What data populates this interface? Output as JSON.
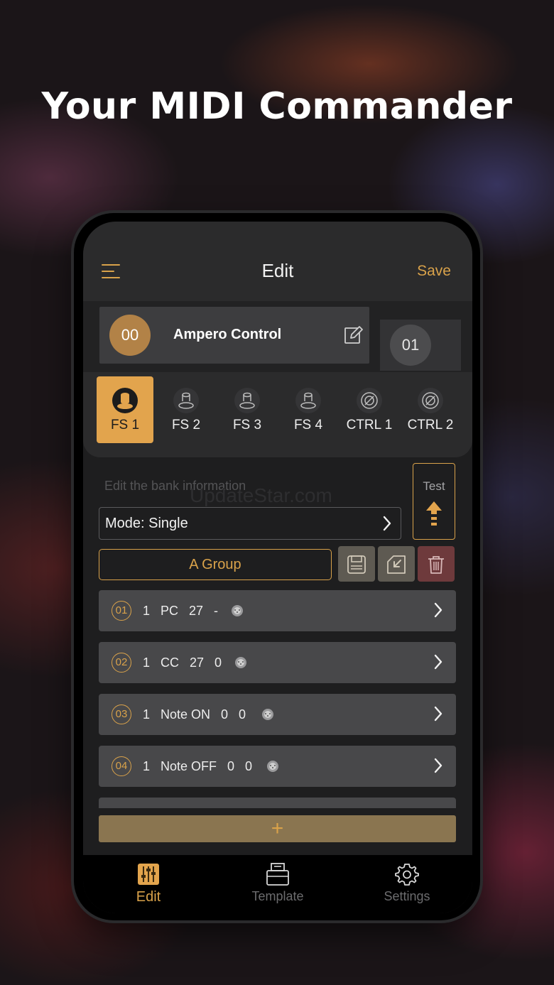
{
  "headline": "Your MIDI Commander",
  "nav": {
    "title": "Edit",
    "save_label": "Save"
  },
  "bank": {
    "number": "00",
    "name": "Ampero Control",
    "next_number": "01"
  },
  "footswitches": [
    {
      "label": "FS 1",
      "type": "footswitch",
      "active": true
    },
    {
      "label": "FS 2",
      "type": "footswitch",
      "active": false
    },
    {
      "label": "FS 3",
      "type": "footswitch",
      "active": false
    },
    {
      "label": "FS 4",
      "type": "footswitch",
      "active": false
    },
    {
      "label": "CTRL 1",
      "type": "knob",
      "active": false
    },
    {
      "label": "CTRL 2",
      "type": "knob",
      "active": false
    }
  ],
  "bank_info_placeholder": "Edit the bank information",
  "watermark": "UpdateStar.com",
  "mode_label": "Mode: Single",
  "test_label": "Test",
  "group_label": "A Group",
  "commands": [
    {
      "index": "01",
      "text": "1   PC   27   -"
    },
    {
      "index": "02",
      "text": "1   CC   27   0"
    },
    {
      "index": "03",
      "text": "1   Note ON   0   0"
    },
    {
      "index": "04",
      "text": "1   Note OFF   0   0"
    }
  ],
  "add_label": "+",
  "tabs": [
    {
      "label": "Edit",
      "icon": "sliders-icon",
      "active": true
    },
    {
      "label": "Template",
      "icon": "template-icon",
      "active": false
    },
    {
      "label": "Settings",
      "icon": "gear-icon",
      "active": false
    }
  ],
  "colors": {
    "accent": "#d9a24a",
    "delete": "#6e3a3c"
  }
}
